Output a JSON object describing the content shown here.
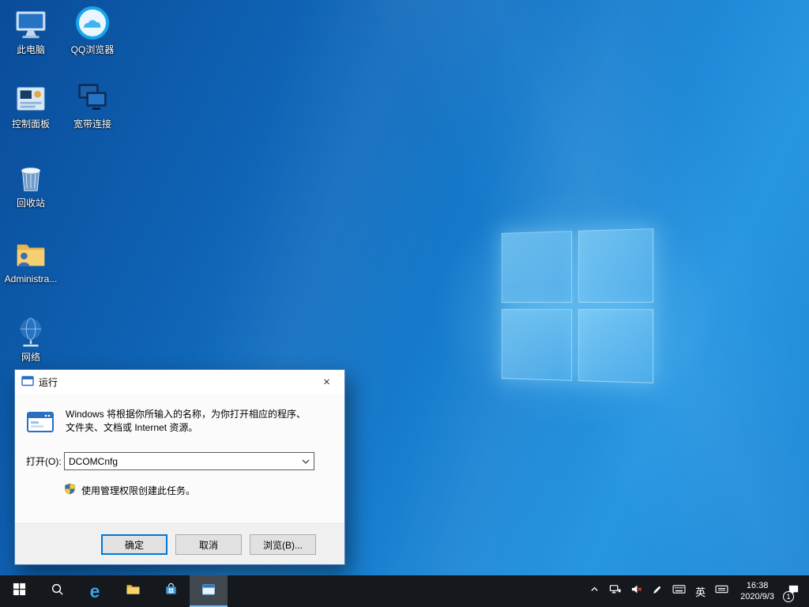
{
  "desktop": {
    "icons": [
      {
        "label": "此电脑"
      },
      {
        "label": "QQ浏览器"
      },
      {
        "label": "控制面板"
      },
      {
        "label": "宽带连接"
      },
      {
        "label": "回收站"
      },
      {
        "label": "Administra..."
      },
      {
        "label": "网络"
      }
    ]
  },
  "run_dialog": {
    "title": "运行",
    "close_symbol": "×",
    "description": "Windows 将根据你所输入的名称，为你打开相应的程序、文件夹、文档或 Internet 资源。",
    "open_label": "打开(O):",
    "input_value": "DCOMCnfg",
    "admin_note": "使用管理权限创建此任务。",
    "buttons": {
      "ok": "确定",
      "cancel": "取消",
      "browse": "浏览(B)..."
    }
  },
  "taskbar": {
    "ime_label": "英",
    "clock": {
      "time": "16:38",
      "date": "2020/9/3"
    },
    "notification_badge": "1"
  },
  "colors": {
    "accent": "#0078d7",
    "taskbar_bg": "#15181c",
    "wallpaper_base": "#1579cb"
  }
}
